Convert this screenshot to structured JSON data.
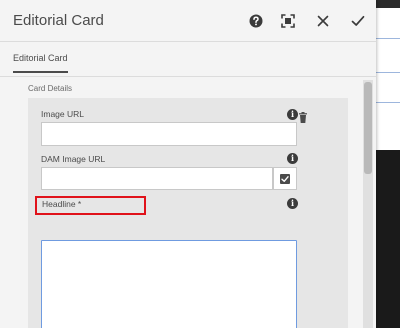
{
  "dialog": {
    "title": "Editorial Card",
    "header_buttons": [
      {
        "name": "help",
        "icon": "help-icon"
      },
      {
        "name": "fullscreen",
        "icon": "fullscreen-icon"
      },
      {
        "name": "close",
        "icon": "close-icon"
      },
      {
        "name": "done",
        "icon": "checkmark-icon"
      }
    ]
  },
  "tabs": [
    {
      "label": "Editorial Card",
      "active": true
    }
  ],
  "section": {
    "label": "Card Details"
  },
  "fields": {
    "image_url": {
      "label": "Image URL",
      "value": ""
    },
    "dam_image_url": {
      "label": "DAM Image URL",
      "value": ""
    },
    "headline": {
      "label": "Headline *",
      "value": ""
    }
  },
  "colors": {
    "highlight": "#e0121a",
    "focus_border": "#6f9be0",
    "dialog_bg": "#f4f4f4"
  }
}
